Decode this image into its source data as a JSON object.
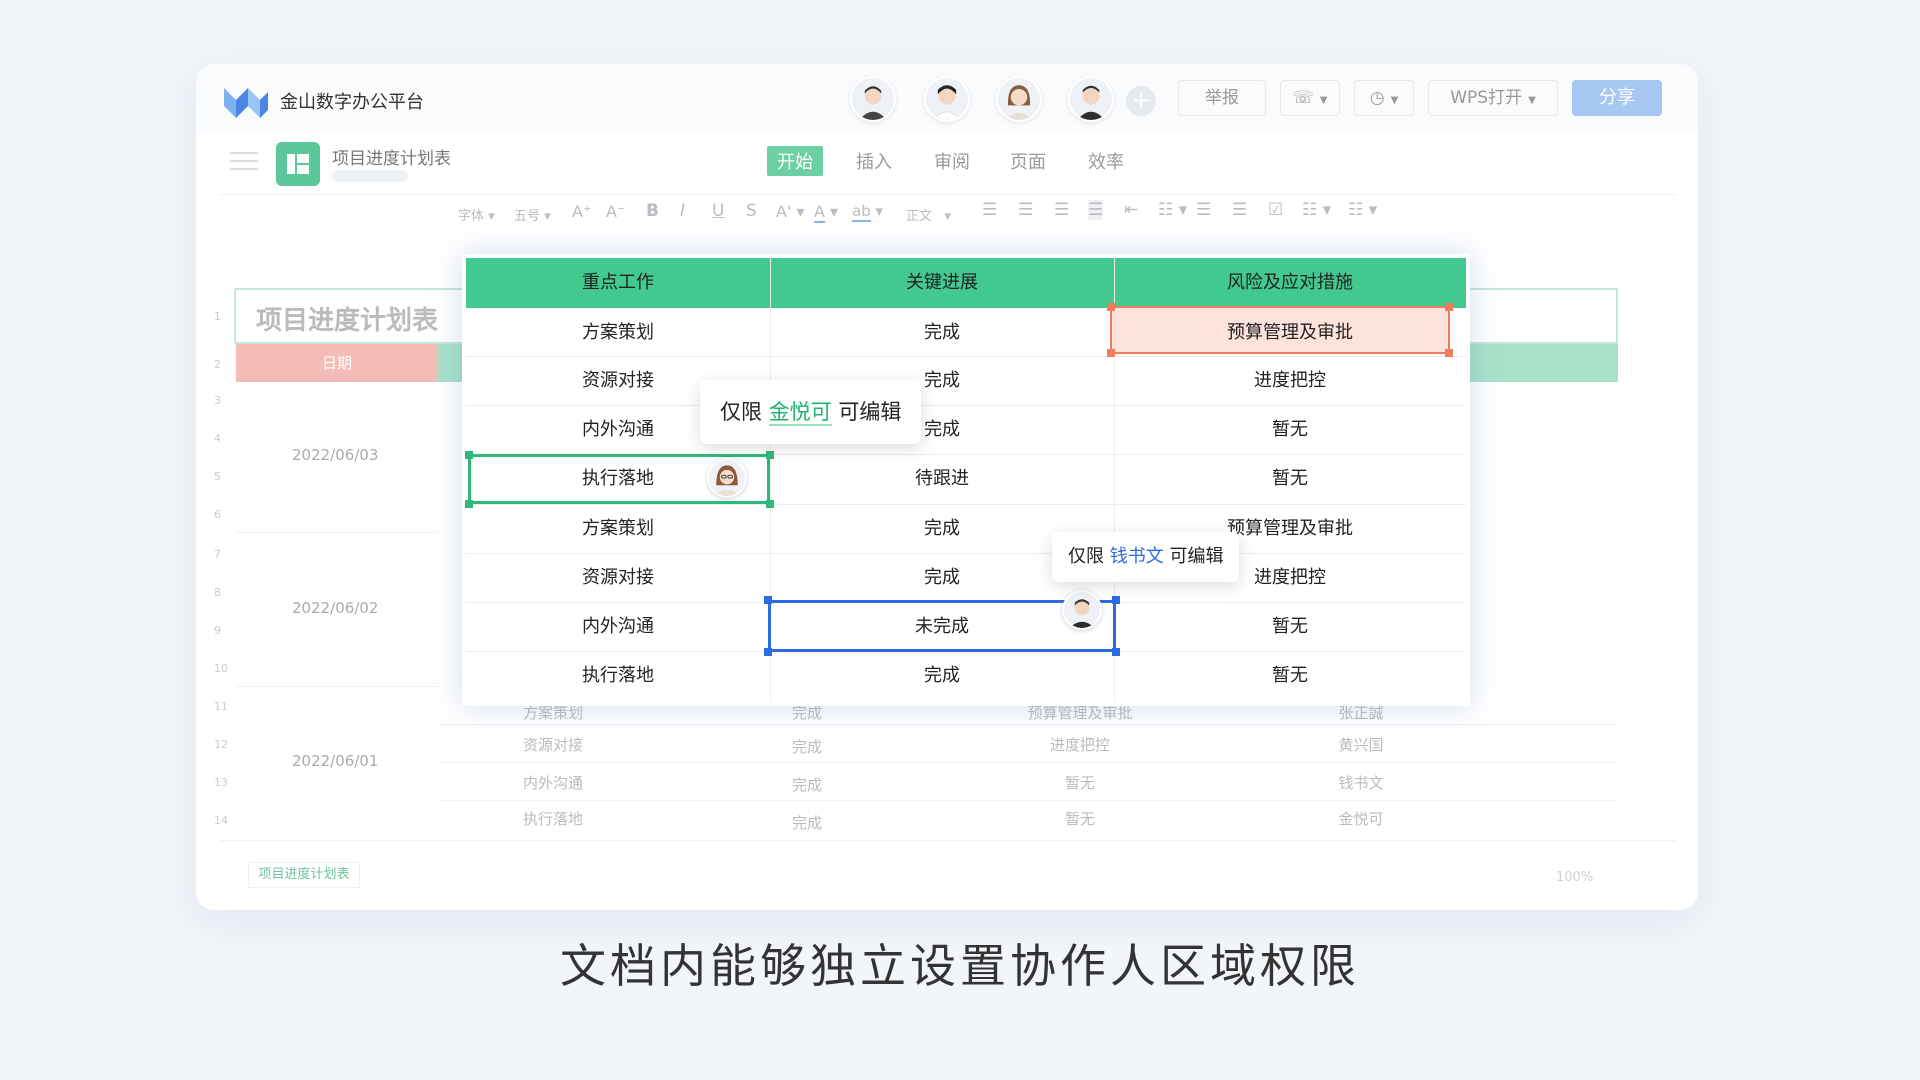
{
  "app": {
    "brand": "金山数字办公平台"
  },
  "topbar": {
    "report_label": "举报",
    "wps_open_label": "WPS打开",
    "share_label": "分享"
  },
  "doc": {
    "title": "项目进度计划表"
  },
  "tabs": [
    "开始",
    "插入",
    "审阅",
    "页面",
    "效率"
  ],
  "format_bar": {
    "font": "字体",
    "size": "五号",
    "style": "正文"
  },
  "background_sheet": {
    "title": "项目进度计划表",
    "date_header": "日期",
    "dates": [
      "2022/06/03",
      "2022/06/02",
      "2022/06/01"
    ],
    "row_numbers": [
      "1",
      "2",
      "3",
      "4",
      "5",
      "6",
      "7",
      "8",
      "9",
      "10",
      "11",
      "12",
      "13",
      "14"
    ],
    "rows": [
      [
        "方案策划",
        "完成",
        "预算管理及审批",
        "张正誠"
      ],
      [
        "资源对接",
        "完成",
        "进度把控",
        "黄兴国"
      ],
      [
        "内外沟通",
        "完成",
        "暂无",
        "钱书文"
      ],
      [
        "执行落地",
        "完成",
        "暂无",
        "金悦可"
      ]
    ],
    "sheet_tab": "项目进度计划表",
    "zoom": "100%"
  },
  "table": {
    "headers": [
      "重点工作",
      "关键进展",
      "风险及应对措施"
    ],
    "rows": [
      [
        "方案策划",
        "完成",
        "预算管理及审批"
      ],
      [
        "资源对接",
        "完成",
        "进度把控"
      ],
      [
        "内外沟通",
        "完成",
        "暂无"
      ],
      [
        "执行落地",
        "待跟进",
        "暂无"
      ],
      [
        "方案策划",
        "完成",
        "预算管理及审批"
      ],
      [
        "资源对接",
        "完成",
        "进度把控"
      ],
      [
        "内外沟通",
        "未完成",
        "暂无"
      ],
      [
        "执行落地",
        "完成",
        "暂无"
      ]
    ]
  },
  "tooltip1": {
    "prefix": "仅限",
    "name": "金悦可",
    "suffix": "可编辑"
  },
  "tooltip2": {
    "prefix": "仅限",
    "name": "钱书文",
    "suffix": "可编辑"
  },
  "caption": "文档内能够独立设置协作人区域权限",
  "colors": {
    "accent_green": "#42c990",
    "selection_red": "#ef7d5d",
    "selection_green": "#2fb879",
    "selection_blue": "#2d6be0",
    "share_button": "#a7c8f3"
  }
}
